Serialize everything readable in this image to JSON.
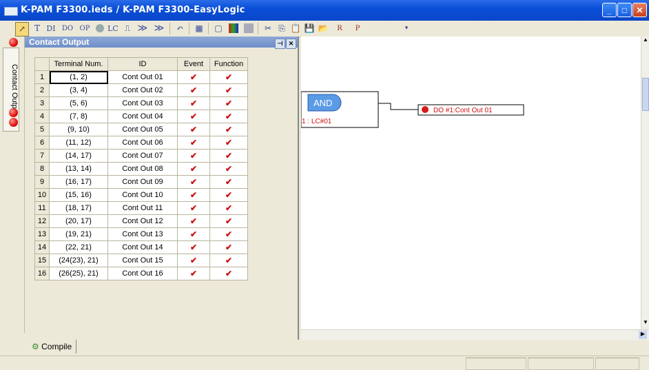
{
  "window": {
    "title": "K-PAM F3300.ieds / K-PAM F3300-EasyLogic"
  },
  "toolbar": {
    "items": [
      "T",
      "DI",
      "DO",
      "OP",
      "LC",
      "≫",
      "≫"
    ]
  },
  "left_tabs": {
    "contact_output": "Contact Output"
  },
  "panel": {
    "title": "Contact Output"
  },
  "table": {
    "headers": [
      "",
      "Terminal Num.",
      "ID",
      "Event",
      "Function"
    ],
    "rows": [
      {
        "n": "1",
        "term": "(1, 2)",
        "id": "Cont Out 01",
        "event": "✔",
        "func": "✔"
      },
      {
        "n": "2",
        "term": "(3, 4)",
        "id": "Cont Out 02",
        "event": "✔",
        "func": "✔"
      },
      {
        "n": "3",
        "term": "(5, 6)",
        "id": "Cont Out 03",
        "event": "✔",
        "func": "✔"
      },
      {
        "n": "4",
        "term": "(7, 8)",
        "id": "Cont Out 04",
        "event": "✔",
        "func": "✔"
      },
      {
        "n": "5",
        "term": "(9, 10)",
        "id": "Cont Out 05",
        "event": "✔",
        "func": "✔"
      },
      {
        "n": "6",
        "term": "(11, 12)",
        "id": "Cont Out 06",
        "event": "✔",
        "func": "✔"
      },
      {
        "n": "7",
        "term": "(14, 17)",
        "id": "Cont Out 07",
        "event": "✔",
        "func": "✔"
      },
      {
        "n": "8",
        "term": "(13, 14)",
        "id": "Cont Out 08",
        "event": "✔",
        "func": "✔"
      },
      {
        "n": "9",
        "term": "(16, 17)",
        "id": "Cont Out 09",
        "event": "✔",
        "func": "✔"
      },
      {
        "n": "10",
        "term": "(15, 16)",
        "id": "Cont Out 10",
        "event": "✔",
        "func": "✔"
      },
      {
        "n": "11",
        "term": "(18, 17)",
        "id": "Cont Out 11",
        "event": "✔",
        "func": "✔"
      },
      {
        "n": "12",
        "term": "(20, 17)",
        "id": "Cont Out 12",
        "event": "✔",
        "func": "✔"
      },
      {
        "n": "13",
        "term": "(19, 21)",
        "id": "Cont Out 13",
        "event": "✔",
        "func": "✔"
      },
      {
        "n": "14",
        "term": "(22, 21)",
        "id": "Cont Out 14",
        "event": "✔",
        "func": "✔"
      },
      {
        "n": "15",
        "term": "(24(23), 21)",
        "id": "Cont Out 15",
        "event": "✔",
        "func": "✔"
      },
      {
        "n": "16",
        "term": "(26(25), 21)",
        "id": "Cont Out 16",
        "event": "✔",
        "func": "✔"
      }
    ]
  },
  "diagram": {
    "gate_label": "AND",
    "gate_id": "1 : LC#01",
    "output_label": "DO #1:Cont Out 01"
  },
  "bottom_tab": {
    "compile": "Compile"
  },
  "colors": {
    "title_bar": "#0A4FD8",
    "check": "#CC1010",
    "gate": "#5B9BE6",
    "wire": "#000000"
  }
}
